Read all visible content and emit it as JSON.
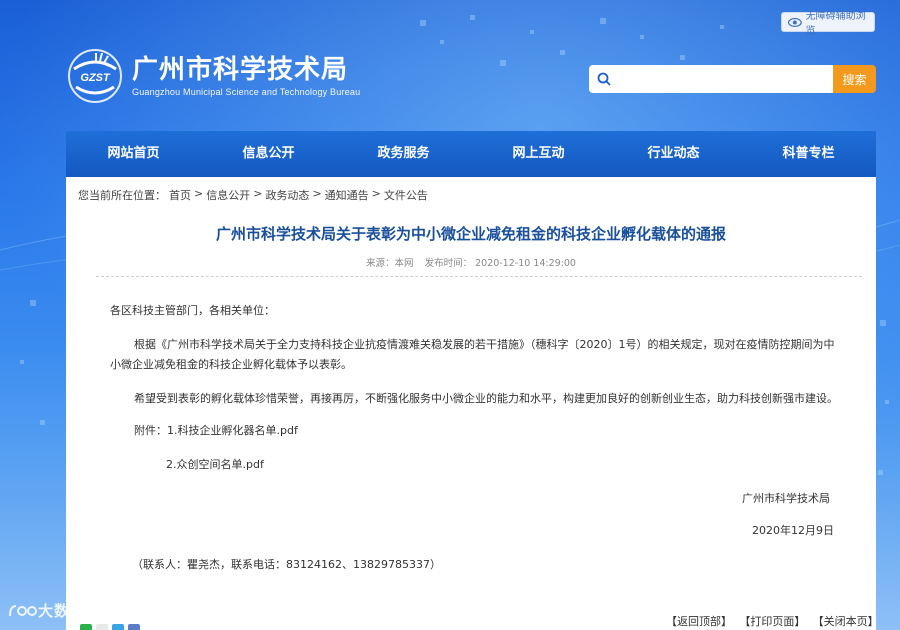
{
  "accessibility": {
    "label": "无障碍辅助浏览"
  },
  "logo": {
    "mark_text": "GZST",
    "name_cn": "广州市科学技术局",
    "name_en": "Guangzhou Municipal Science and Technology Bureau"
  },
  "search": {
    "placeholder": "",
    "value": "",
    "button_label": "搜索"
  },
  "nav": {
    "items": [
      {
        "label": "网站首页"
      },
      {
        "label": "信息公开"
      },
      {
        "label": "政务服务"
      },
      {
        "label": "网上互动"
      },
      {
        "label": "行业动态"
      },
      {
        "label": "科普专栏"
      }
    ]
  },
  "breadcrumb": {
    "prefix": "您当前所在位置：",
    "items": [
      "首页",
      "信息公开",
      "政务动态",
      "通知通告",
      "文件公告"
    ],
    "separator": ">"
  },
  "article": {
    "title": "广州市科学技术局关于表彰为中小微企业减免租金的科技企业孵化载体的通报",
    "source": "来源：本网",
    "published": "发布时间： 2020-12-10 14:29:00",
    "salutation": "各区科技主管部门，各相关单位：",
    "para1_line1": "根据《广州市科学技术局关于全力支持科技企业抗疫情渡难关稳发展的若干措施》（穗科字〔2020〕1号）的相关规定，现对在疫情防控期间为中",
    "para1_line2": "小微企业减免租金的科技企业孵化载体予以表彰。",
    "para2": "希望受到表彰的孵化载体珍惜荣誉，再接再厉，不断强化服务中小微企业的能力和水平，构建更加良好的创新创业生态，助力科技创新强市建设。",
    "attachment1": "附件：1.科技企业孵化器名单.pdf",
    "attachment2": "2.众创空间名单.pdf",
    "signature": "广州市科学技术局",
    "date": "2020年12月9日",
    "contact": "（联系人：瞿尧杰，联系电话：83124162、13829785337）"
  },
  "footer": {
    "back_top": "【返回顶部】",
    "print": "【打印页面】",
    "close": "【关闭本页】"
  },
  "watermark": {
    "text": "大数跨境"
  },
  "colors": {
    "nav_bg": "#1766cf",
    "title": "#1a4f9c",
    "search_button": "#f39a1e"
  }
}
